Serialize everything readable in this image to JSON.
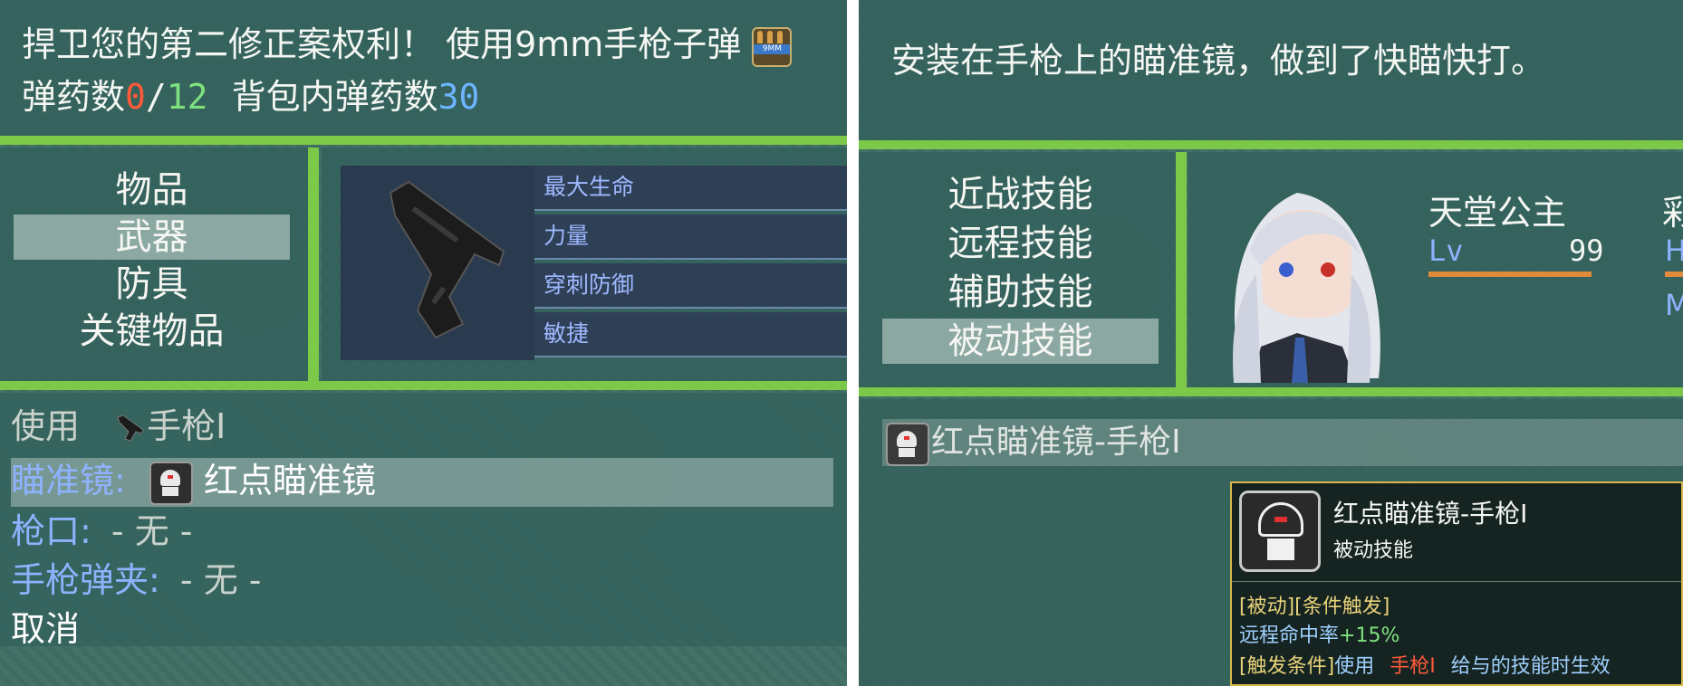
{
  "left": {
    "help": {
      "line1_text": "捍卫您的第二修正案权利！ 使用9mm手枪子弹",
      "ammo_icon_label": "9MM",
      "ammo_label": "弹药数",
      "ammo_current": "0",
      "ammo_sep": "/",
      "ammo_max": "12",
      "bag_label": "背包内弹药数",
      "bag_count": "30"
    },
    "categories": [
      "物品",
      "武器",
      "防具",
      "关键物品"
    ],
    "selected_category": "武器",
    "stats": [
      "最大生命",
      "力量",
      "穿刺防御",
      "敏捷"
    ],
    "equip": {
      "use_label": "使用",
      "weapon_name": "手枪Ⅰ",
      "slots": [
        {
          "label": "瞄准镜:",
          "value": "红点瞄准镜",
          "selected": true
        },
        {
          "label": "枪口:",
          "value": "- 无 -"
        },
        {
          "label": "手枪弹夹:",
          "value": "- 无 -"
        }
      ],
      "cancel": "取消"
    }
  },
  "right": {
    "help_text": "安装在手枪上的瞄准镜，做到了快瞄快打。",
    "skill_types": [
      "近战技能",
      "远程技能",
      "辅助技能",
      "被动技能"
    ],
    "selected_skill_type": "被动技能",
    "actor": {
      "name": "天堂公主",
      "lv_label": "Lv",
      "level": "99",
      "partial_hp_label": "H",
      "partial_mp_label": "M",
      "partial_name_char": "彩"
    },
    "skill_item": "红点瞄准镜-手枪Ⅰ",
    "tooltip": {
      "name": "红点瞄准镜-手枪Ⅰ",
      "type": "被动技能",
      "tags_text": "[被动][条件触发]",
      "effect_label": "远程命中率",
      "effect_value": "+15%",
      "cond_label": "[触发条件]",
      "cond_pre": "使用",
      "cond_weapon": "手枪Ⅰ",
      "cond_post": "给与的技能时生效"
    }
  },
  "colors": {
    "red": "#ff5a3a",
    "green": "#7fe07f",
    "blue": "#6cb4ff",
    "accent_green": "#7cc94a",
    "tooltip_border": "#d6b84a"
  }
}
